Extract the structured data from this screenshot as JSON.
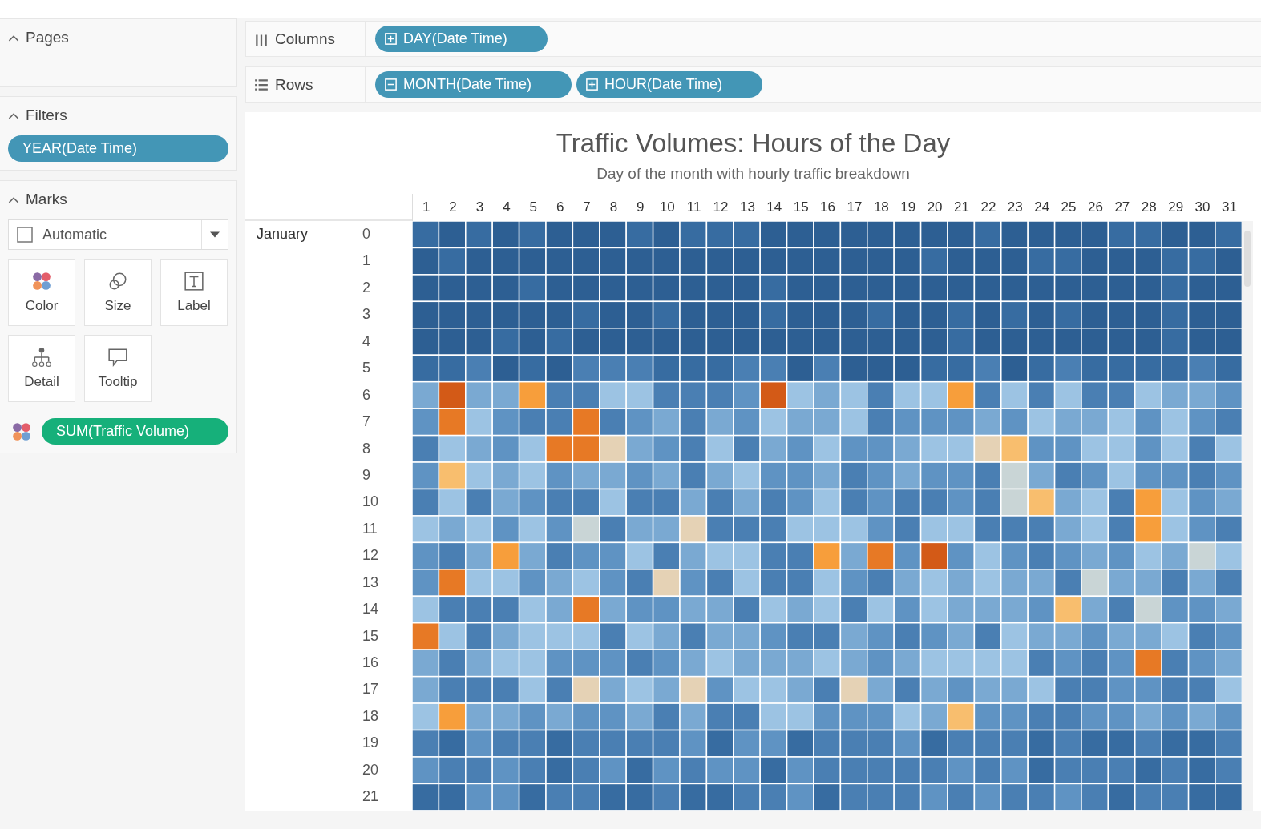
{
  "sidebar": {
    "pages": {
      "title": "Pages",
      "expanded": true
    },
    "filters": {
      "title": "Filters",
      "expanded": true,
      "pills": [
        "YEAR(Date Time)"
      ]
    },
    "marks": {
      "title": "Marks",
      "expanded": true,
      "mark_type": "Automatic",
      "cards": [
        {
          "kind": "color",
          "label": "Color"
        },
        {
          "kind": "size",
          "label": "Size"
        },
        {
          "kind": "label",
          "label": "Label"
        },
        {
          "kind": "detail",
          "label": "Detail"
        },
        {
          "kind": "tooltip",
          "label": "Tooltip"
        }
      ],
      "encoding_pill": {
        "kind": "color",
        "label": "SUM(Traffic Volume)"
      }
    }
  },
  "shelves": [
    {
      "kind": "columns",
      "label": "Columns",
      "pills": [
        {
          "label": "DAY(Date Time)",
          "expanded": false
        }
      ]
    },
    {
      "kind": "rows",
      "label": "Rows",
      "pills": [
        {
          "label": "MONTH(Date Time)",
          "expanded": true
        },
        {
          "label": "HOUR(Date Time)",
          "expanded": false
        }
      ]
    }
  ],
  "chart": {
    "title": "Traffic Volumes: Hours of the Day",
    "subtitle": "Day of the month with hourly traffic breakdown",
    "columns": [
      "1",
      "2",
      "3",
      "4",
      "5",
      "6",
      "7",
      "8",
      "9",
      "10",
      "11",
      "12",
      "13",
      "14",
      "15",
      "16",
      "17",
      "18",
      "19",
      "20",
      "21",
      "22",
      "23",
      "24",
      "25",
      "26",
      "27",
      "28",
      "29",
      "30",
      "31"
    ],
    "month": "January",
    "hours": [
      "0",
      "1",
      "2",
      "3",
      "4",
      "5",
      "6",
      "7",
      "8",
      "9",
      "10",
      "11",
      "12",
      "13",
      "14",
      "15",
      "16",
      "17",
      "18",
      "19",
      "20",
      "21"
    ]
  }
}
